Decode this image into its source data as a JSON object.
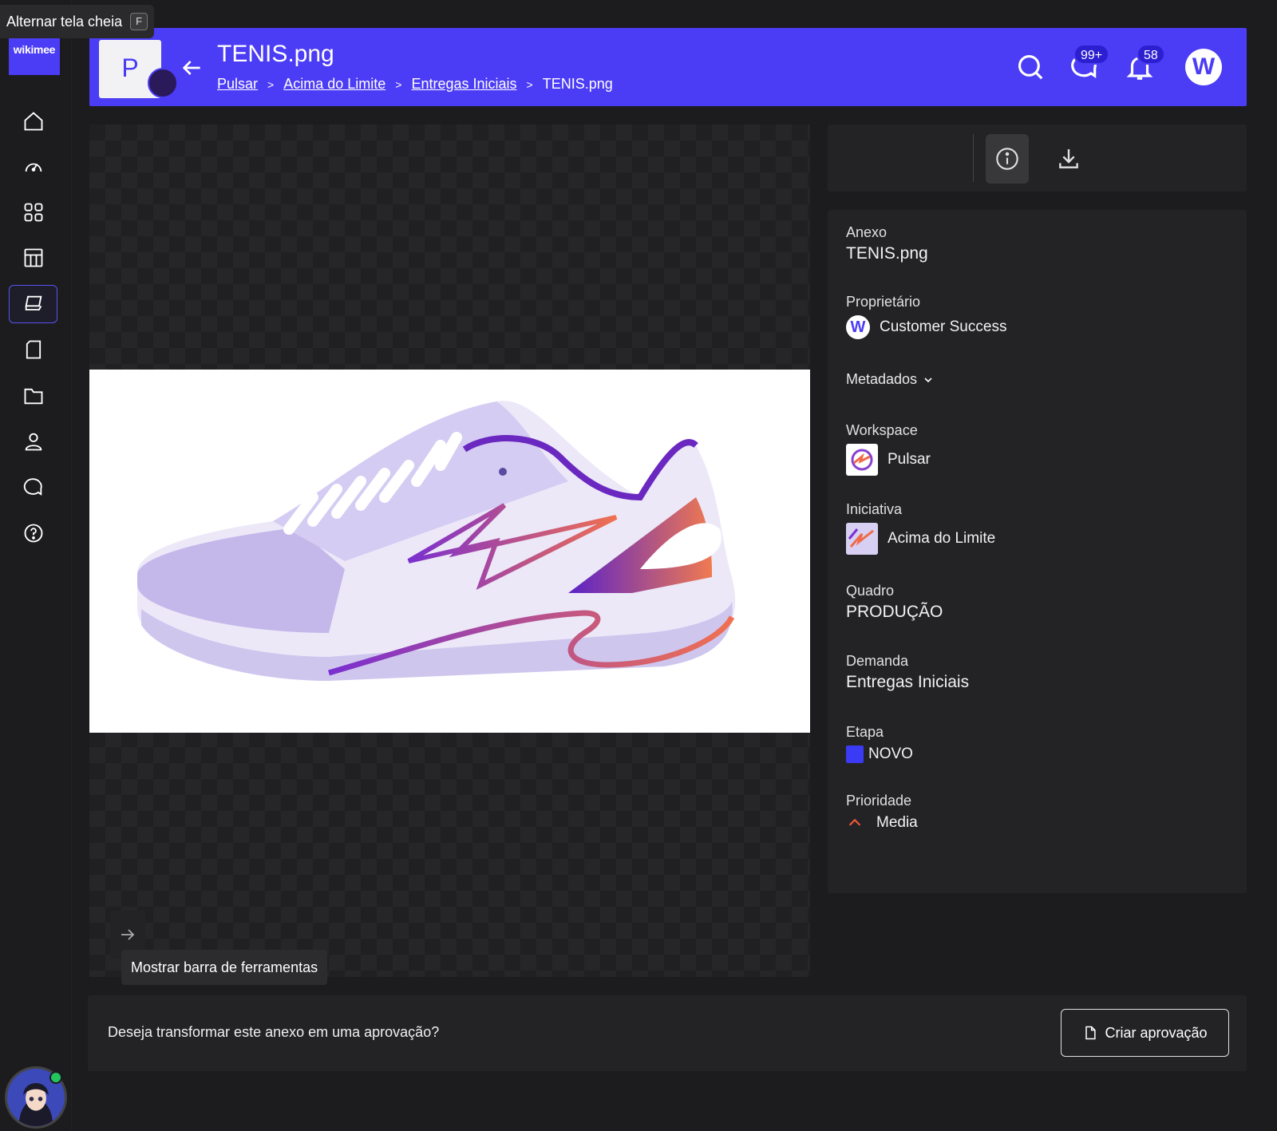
{
  "tooltip_fullscreen": {
    "label": "Alternar tela cheia",
    "key": "F"
  },
  "brand": {
    "logo_text": "wikimee"
  },
  "sidebar": {
    "items": [
      {
        "icon": "home-icon"
      },
      {
        "icon": "dashboard-icon"
      },
      {
        "icon": "grid-icon"
      },
      {
        "icon": "layout-icon"
      },
      {
        "icon": "cards-icon",
        "active": true
      },
      {
        "icon": "document-icon"
      },
      {
        "icon": "folder-icon"
      },
      {
        "icon": "user-icon"
      },
      {
        "icon": "chat-icon"
      },
      {
        "icon": "help-icon"
      }
    ]
  },
  "header": {
    "project_letter": "P",
    "title": "TENIS.png",
    "breadcrumb": [
      "Pulsar",
      "Acima do Limite",
      "Entregas Iniciais",
      "TENIS.png"
    ],
    "chat_badge": "99+",
    "notif_badge": "58",
    "avatar_letter": "W",
    "accent": "#4b3cf5"
  },
  "viewer": {
    "toolbar_tooltip": "Mostrar barra de ferramentas"
  },
  "details": {
    "anexo": {
      "label": "Anexo",
      "value": "TENIS.png"
    },
    "proprietario": {
      "label": "Proprietário",
      "value": "Customer Success",
      "avatar_letter": "W"
    },
    "metadados": {
      "label": "Metadados"
    },
    "workspace": {
      "label": "Workspace",
      "value": "Pulsar"
    },
    "iniciativa": {
      "label": "Iniciativa",
      "value": "Acima do Limite"
    },
    "quadro": {
      "label": "Quadro",
      "value": "PRODUÇÃO"
    },
    "demanda": {
      "label": "Demanda",
      "value": "Entregas Iniciais"
    },
    "etapa": {
      "label": "Etapa",
      "value": "NOVO",
      "color": "#3b3af5"
    },
    "prioridade": {
      "label": "Prioridade",
      "value": "Media",
      "color": "#f0573a"
    }
  },
  "approval": {
    "question": "Deseja transformar este anexo em uma aprovação?",
    "button_label": "Criar aprovação"
  }
}
